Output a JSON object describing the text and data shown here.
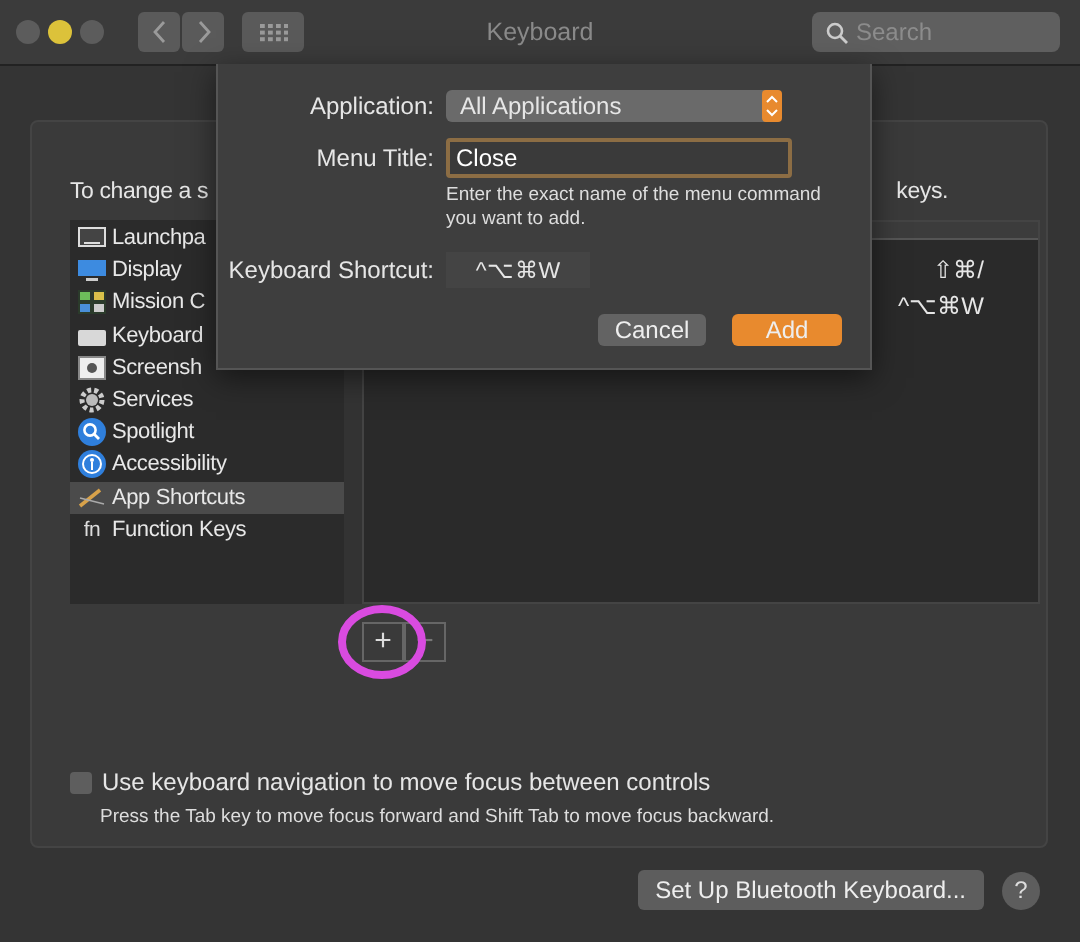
{
  "window": {
    "title": "Keyboard",
    "search": {
      "placeholder": "Search"
    },
    "traffic_lights": [
      {
        "color": "#5c5c5c"
      },
      {
        "color": "#dcc23a"
      },
      {
        "color": "#5c5c5c"
      }
    ]
  },
  "panel": {
    "intro_text": "To change a s",
    "intro_text_end": "keys.",
    "sidebar": {
      "items": [
        {
          "label": "Launchpa",
          "kind": "launchpad",
          "selected": false
        },
        {
          "label": "Display",
          "kind": "display",
          "selected": false
        },
        {
          "label": "Mission C",
          "kind": "mission",
          "selected": false
        },
        {
          "label": "Keyboard",
          "kind": "keyboard",
          "selected": false
        },
        {
          "label": "Screensh",
          "kind": "screenshot",
          "selected": false
        },
        {
          "label": "Services",
          "kind": "services",
          "selected": false
        },
        {
          "label": "Spotlight",
          "kind": "spotlight",
          "selected": false
        },
        {
          "label": "Accessibility",
          "kind": "accessibility",
          "selected": false
        },
        {
          "label": "App Shortcuts",
          "kind": "app",
          "selected": true
        },
        {
          "label": "Function Keys",
          "kind": "fn",
          "icon_text": "fn",
          "selected": false
        }
      ]
    },
    "table": {
      "rows": [
        {
          "shortcut": "⇧⌘/"
        },
        {
          "shortcut": "^⌥⌘W"
        }
      ]
    },
    "add_button": "+",
    "remove_button": "−",
    "keyboard_navigation": {
      "label": "Use keyboard navigation to move focus between controls",
      "checked": false,
      "hint": "Press the Tab key to move focus forward and Shift Tab to move focus backward."
    }
  },
  "footer": {
    "button": "Set Up Bluetooth Keyboard...",
    "help": "?"
  },
  "sheet": {
    "application": {
      "label": "Application:",
      "value": "All Applications"
    },
    "menu_title": {
      "label": "Menu Title:",
      "value": "Close",
      "hint": "Enter the exact name of the menu command you want to add."
    },
    "shortcut": {
      "label": "Keyboard Shortcut:",
      "value": "^⌥⌘W"
    },
    "buttons": [
      {
        "label": "Cancel",
        "default": false
      },
      {
        "label": "Add",
        "default": true
      }
    ]
  }
}
